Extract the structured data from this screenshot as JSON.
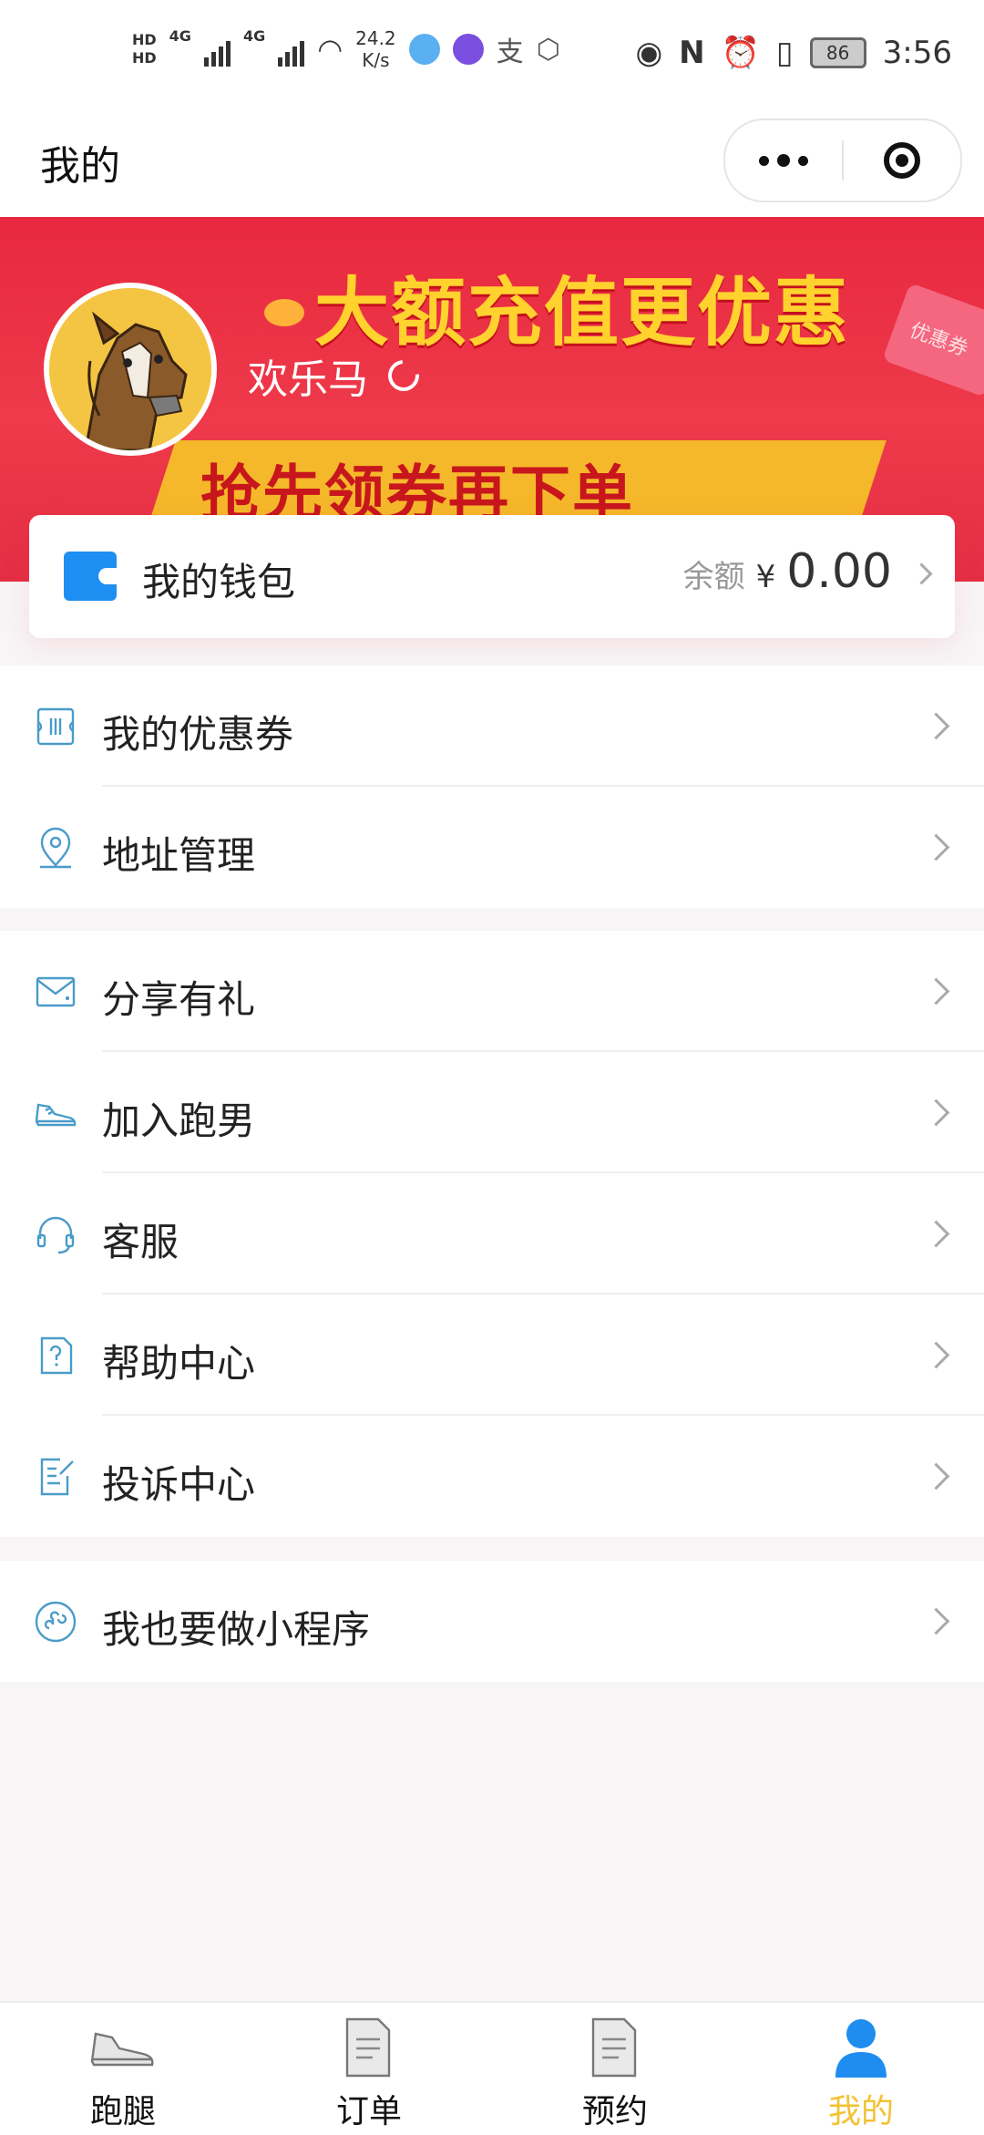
{
  "status_bar": {
    "network_1": "4G",
    "network_2": "4G",
    "speed_value": "24.2",
    "speed_unit": "K/s",
    "battery": "86",
    "time": "3:56"
  },
  "nav": {
    "title": "我的"
  },
  "banner": {
    "headline": "大额充值更优惠",
    "subline": "抢先领券再下单",
    "ticket_text": "优惠券"
  },
  "profile": {
    "username": "欢乐马"
  },
  "wallet": {
    "label": "我的钱包",
    "balance_label": "余额",
    "currency": "¥",
    "amount": "0.00"
  },
  "menu_groups": [
    {
      "items": [
        {
          "label": "我的优惠券",
          "icon": "coupon-icon"
        },
        {
          "label": "地址管理",
          "icon": "location-pin-icon"
        }
      ]
    },
    {
      "items": [
        {
          "label": "分享有礼",
          "icon": "envelope-icon"
        },
        {
          "label": "加入跑男",
          "icon": "sneaker-icon"
        },
        {
          "label": "客服",
          "icon": "headset-icon"
        },
        {
          "label": "帮助中心",
          "icon": "help-doc-icon"
        },
        {
          "label": "投诉中心",
          "icon": "edit-doc-icon"
        }
      ]
    },
    {
      "items": [
        {
          "label": "我也要做小程序",
          "icon": "mini-program-icon"
        }
      ]
    }
  ],
  "tabbar": {
    "tabs": [
      {
        "label": "跑腿",
        "icon": "sneaker-icon"
      },
      {
        "label": "订单",
        "icon": "document-icon"
      },
      {
        "label": "预约",
        "icon": "document-icon"
      },
      {
        "label": "我的",
        "icon": "user-icon",
        "active": true
      }
    ]
  },
  "colors": {
    "accent_tab": "#f2c233",
    "banner_red": "#e8283f",
    "headline_yellow": "#ffd22e",
    "wallet_blue": "#1e8ff2",
    "icon_blue": "#4a9cc9"
  }
}
